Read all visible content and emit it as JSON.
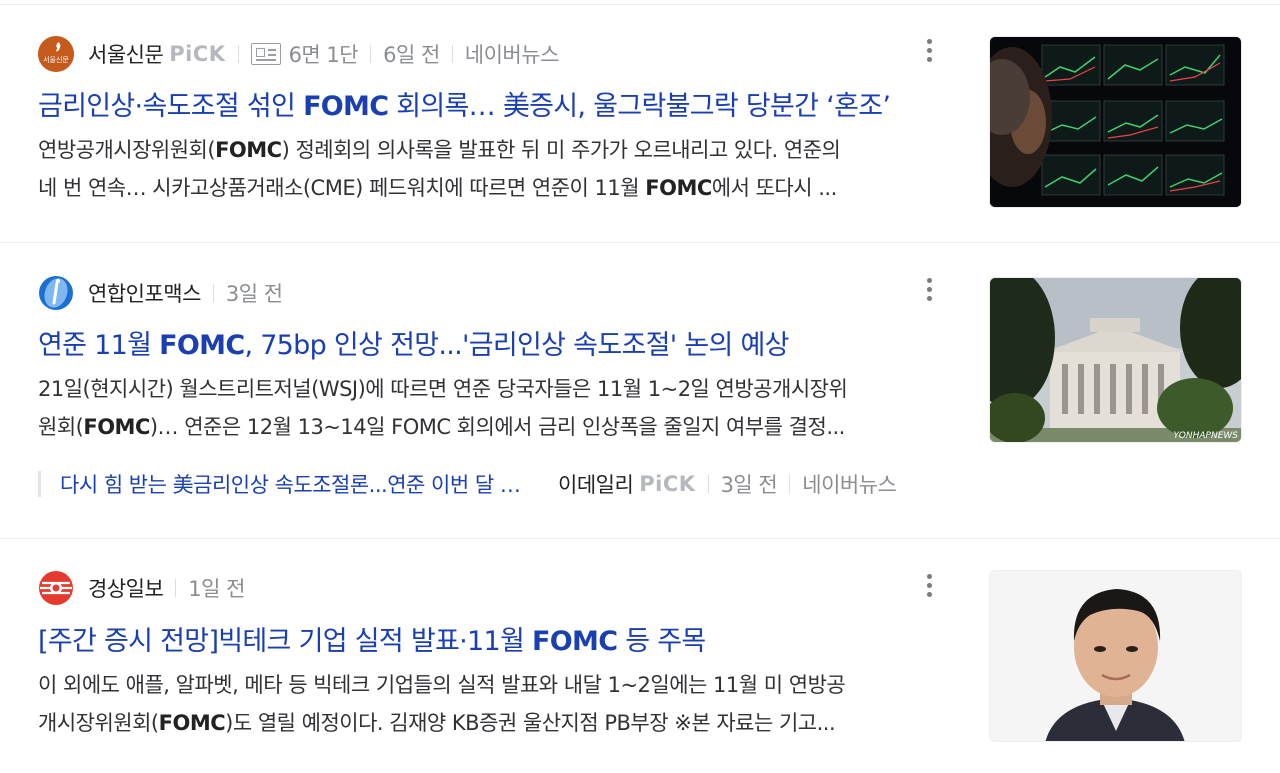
{
  "items": [
    {
      "press": "서울신문",
      "pick": "PiCK",
      "paper_label": "6면 1단",
      "time": "6일 전",
      "source": "네이버뉴스",
      "title_pre": "금리인상·속도조절 섞인 ",
      "title_bold": "FOMC",
      "title_post": " 회의록… 美증시, 울그락불그락 당분간 ‘혼조’",
      "desc_line1": [
        "연방공개시장위원회(",
        "FOMC",
        ") 정례회의 의사록을 발표한 뒤 미 주가가 오르내리고 있다. 연준의"
      ],
      "desc_line2": [
        "네 번 연속… 시카고상품거래소(CME) 페드워치에 따르면 연준이 11월 ",
        "FOMC",
        "에서 또다시 ..."
      ]
    },
    {
      "press": "연합인포맥스",
      "time": "3일 전",
      "title_pre": "연준 11월 ",
      "title_bold": "FOMC",
      "title_post": ", 75bp 인상 전망...'금리인상 속도조절' 논의 예상",
      "desc_line1": [
        "21일(현지시간) 월스트리트저널(WSJ)에 따르면 연준 당국자들은 11월 1~2일 연방공개시장위",
        "",
        ""
      ],
      "desc_line2": [
        "원회(",
        "FOMC",
        ")… 연준은 12월 13~14일 FOMC 회의에서 금리 인상폭을 줄일지 여부를 결정..."
      ],
      "related": {
        "title": "다시 힘 받는 美금리인상 속도조절론...연준 이번 달 FOMC",
        "press": "이데일리",
        "pick": "PiCK",
        "time": "3일 전",
        "source": "네이버뉴스"
      }
    },
    {
      "press": "경상일보",
      "time": "1일 전",
      "title_pre": "[주간 증시 전망]빅테크 기업 실적 발표·11월 ",
      "title_bold": "FOMC",
      "title_post": " 등 주목",
      "desc_line1": [
        "이 외에도 애플, 알파벳, 메타 등 빅테크 기업들의 실적 발표와 내달 1~2일에는 11월 미 연방공",
        "",
        ""
      ],
      "desc_line2": [
        "개시장위원회(",
        "FOMC",
        ")도 열릴 예정이다. 김재양 KB증권 울산지점 PB부장 ※본 자료는 기고..."
      ]
    }
  ],
  "logos": {
    "seoul_text": "서울신문",
    "watermark": "YONHAPNEWS"
  },
  "colors": {
    "title_blue": "#1a3fb3",
    "meta_gray": "#8a8d93",
    "pick_gray": "#b5b8bd"
  },
  "icons": [
    "newspaper-icon",
    "more-vertical-icon"
  ]
}
